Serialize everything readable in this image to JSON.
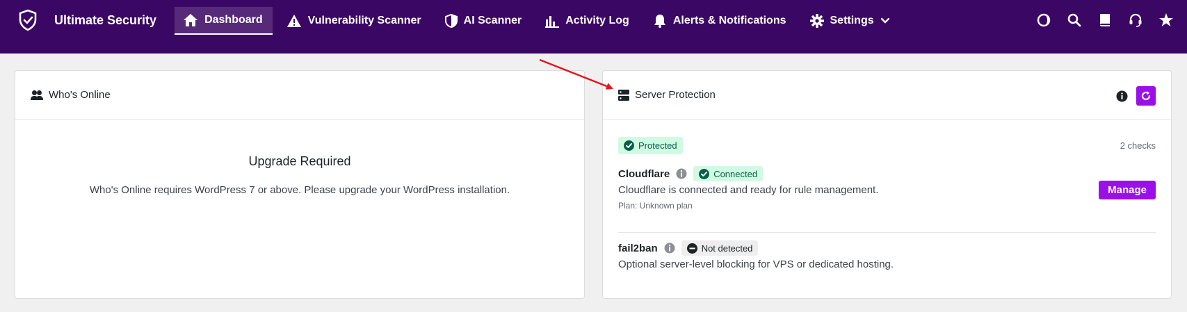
{
  "app": {
    "name": "Ultimate Security",
    "logo_icon": "shield-check-icon"
  },
  "nav": {
    "items": [
      {
        "id": "dashboard",
        "label": "Dashboard",
        "icon": "home-icon",
        "active": true
      },
      {
        "id": "vulnerability-scanner",
        "label": "Vulnerability Scanner",
        "icon": "warning-icon"
      },
      {
        "id": "ai-scanner",
        "label": "AI Scanner",
        "icon": "shield-half-icon"
      },
      {
        "id": "activity-log",
        "label": "Activity Log",
        "icon": "bar-chart-icon"
      },
      {
        "id": "alerts",
        "label": "Alerts & Notifications",
        "icon": "bell-icon"
      },
      {
        "id": "settings",
        "label": "Settings",
        "icon": "gear-icon",
        "dropdown": true
      }
    ],
    "right_icons": [
      "theme-toggle-icon",
      "search-icon",
      "book-icon",
      "support-headset-icon",
      "star-icon"
    ]
  },
  "whos_online": {
    "title": "Who's Online",
    "icon": "users-icon",
    "upgrade_title": "Upgrade Required",
    "upgrade_text": "Who's Online requires WordPress 7 or above. Please upgrade your WordPress installation."
  },
  "server_protection": {
    "title": "Server Protection",
    "icon": "server-icon",
    "status": "Protected",
    "checks": "2 checks",
    "providers": [
      {
        "name": "Cloudflare",
        "status": "Connected",
        "description": "Cloudflare is connected and ready for rule management.",
        "plan": "Plan: Unknown plan",
        "action": "Manage"
      },
      {
        "name": "fail2ban",
        "status": "Not detected",
        "description": "Optional server-level blocking for VPS or dedicated hosting."
      }
    ]
  },
  "colors": {
    "topbar": "#3b0764",
    "accent": "#9b10e8",
    "success_bg": "#d1fae5",
    "success_fg": "#065f46",
    "annotation_arrow": "#e8141c"
  }
}
